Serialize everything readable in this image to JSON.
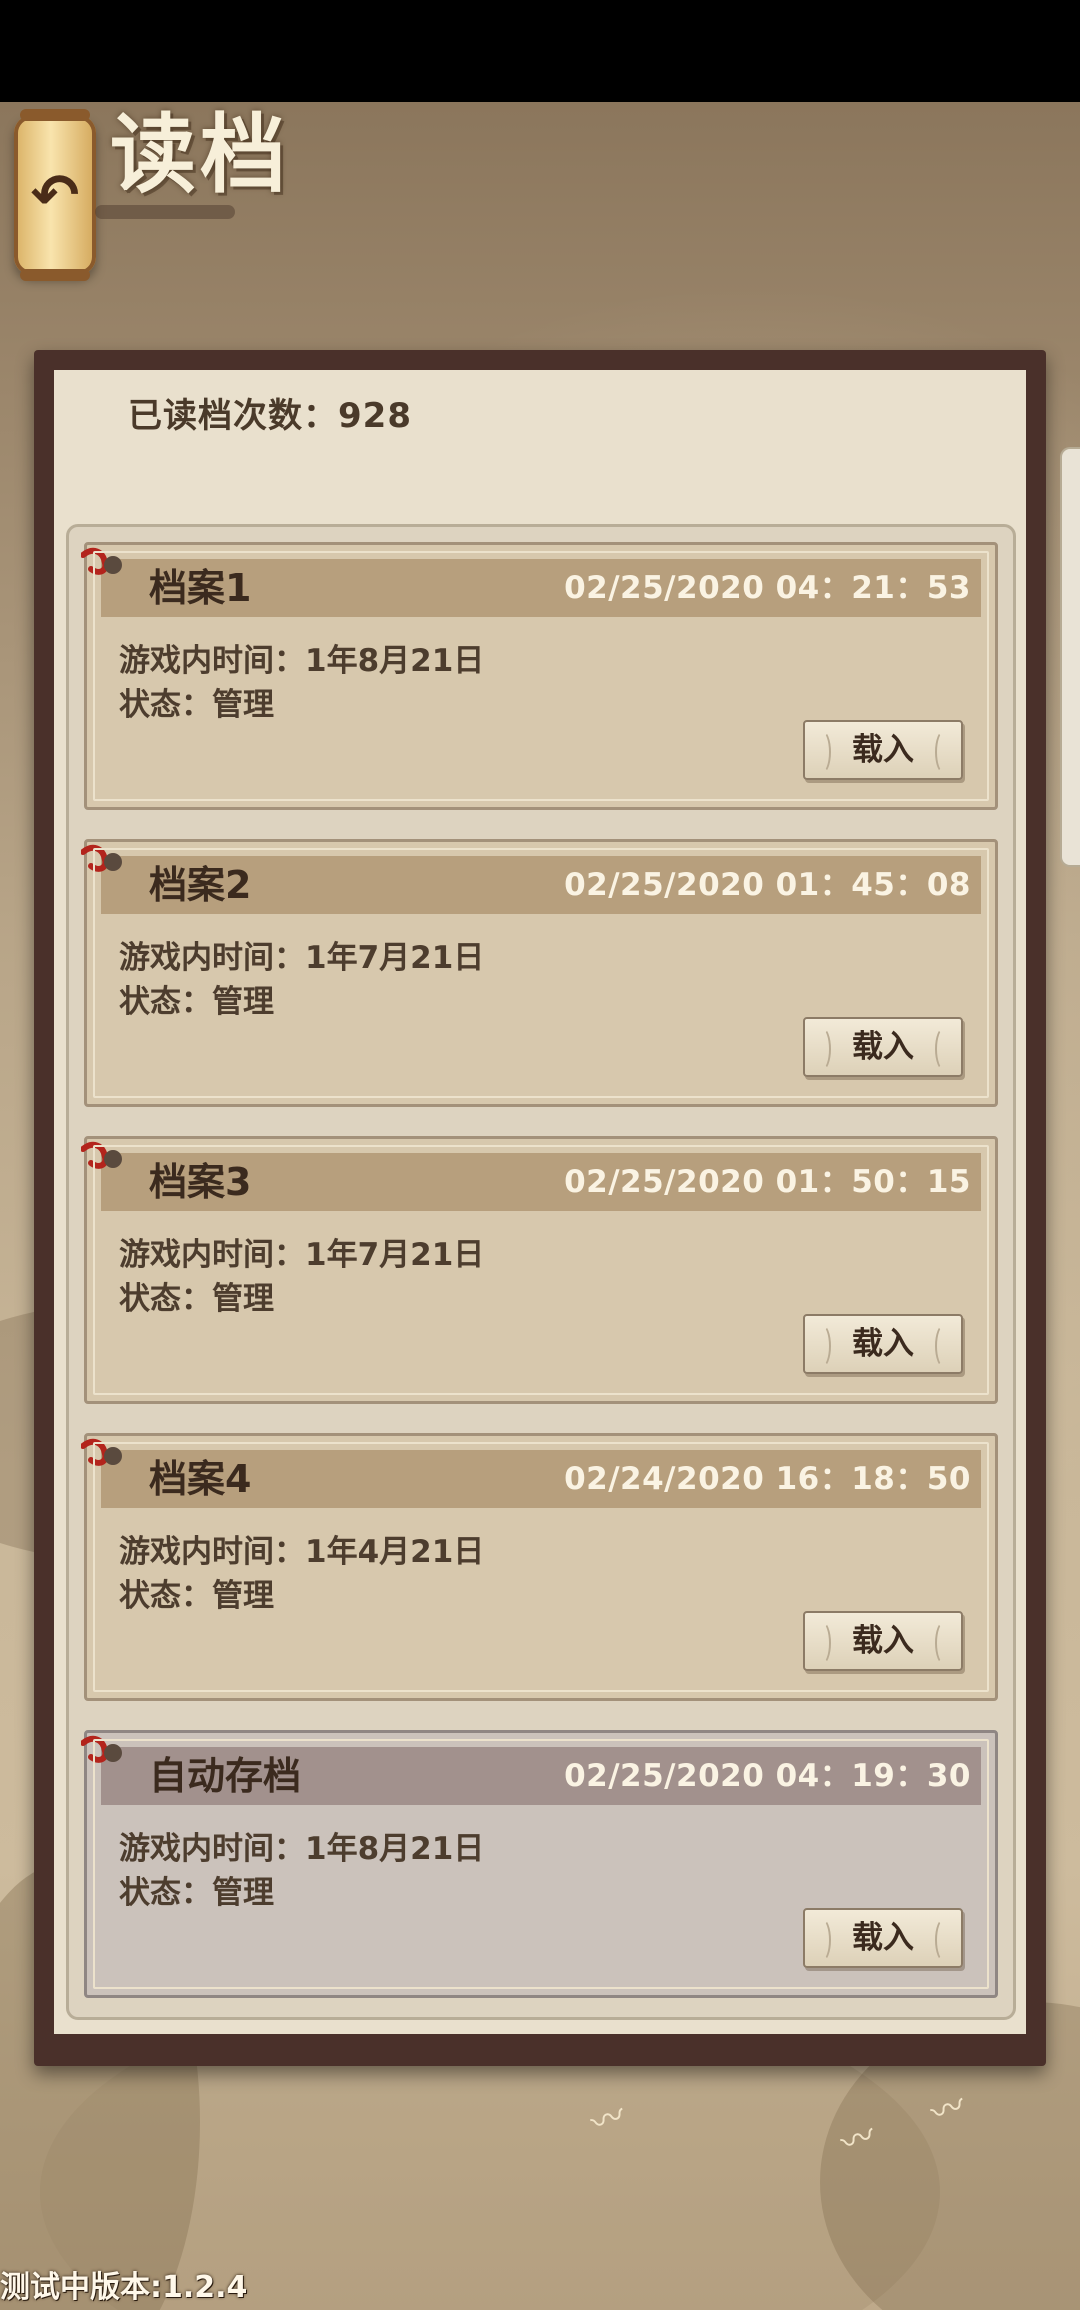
{
  "header": {
    "title": "读档",
    "back_icon": "back-arrow-icon"
  },
  "panel": {
    "read_count_label": "已读档次数：928"
  },
  "saves": [
    {
      "name": "档案1",
      "timestamp": "02/25/2020  04：21：53",
      "game_time": "游戏内时间：1年8月21日",
      "status": "状态：管理",
      "button": "载入",
      "auto": false
    },
    {
      "name": "档案2",
      "timestamp": "02/25/2020  01：45：08",
      "game_time": "游戏内时间：1年7月21日",
      "status": "状态：管理",
      "button": "载入",
      "auto": false
    },
    {
      "name": "档案3",
      "timestamp": "02/25/2020  01：50：15",
      "game_time": "游戏内时间：1年7月21日",
      "status": "状态：管理",
      "button": "载入",
      "auto": false
    },
    {
      "name": "档案4",
      "timestamp": "02/24/2020  16：18：50",
      "game_time": "游戏内时间：1年4月21日",
      "status": "状态：管理",
      "button": "载入",
      "auto": false
    },
    {
      "name": "自动存档",
      "timestamp": "02/25/2020  04：19：30",
      "game_time": "游戏内时间：1年8月21日",
      "status": "状态：管理",
      "button": "载入",
      "auto": true
    }
  ],
  "footer": {
    "version": "测试中版本:1.2.4"
  },
  "colors": {
    "panel_frame": "#4a302a",
    "card_bg": "#d7c8ad",
    "card_header": "#b79f7d",
    "auto_card_bg": "#cbc2bb",
    "auto_card_header": "#a2918d",
    "pin_ribbon": "#b3241c"
  }
}
